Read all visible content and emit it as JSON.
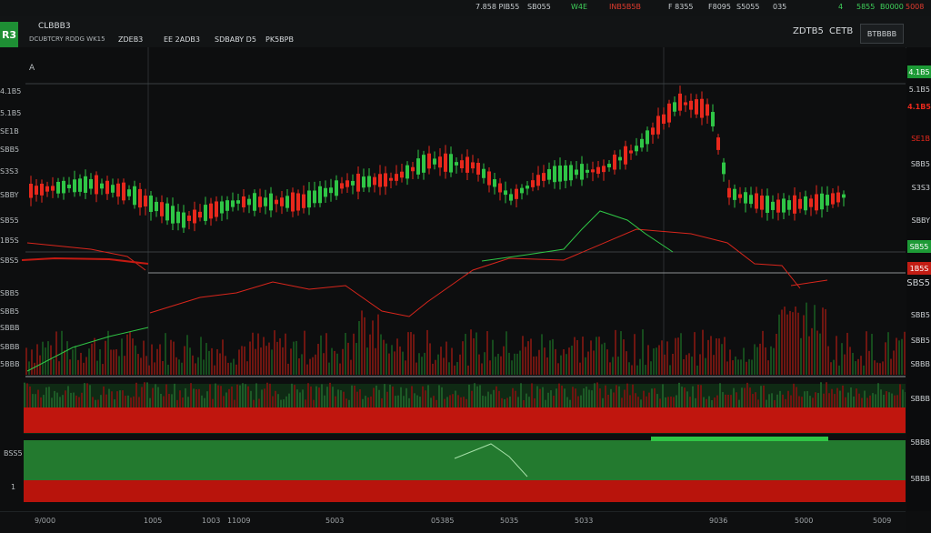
{
  "topbar": {
    "items": [
      {
        "text": "7.858 PIB55"
      },
      {
        "text": "SB055"
      },
      {
        "text": "W4E"
      },
      {
        "text": "INB5B5B"
      },
      {
        "text": "F 8355"
      },
      {
        "text": "F8095"
      },
      {
        "text": "S5055"
      },
      {
        "text": "035"
      },
      {
        "text": "4"
      },
      {
        "text": "5855"
      },
      {
        "text": "B0000"
      },
      {
        "text": "5008"
      }
    ]
  },
  "header": {
    "logo": "R3",
    "symbol": "CLBBB3",
    "subtitle": "DCUBTCRY RDDG WK15",
    "fields": [
      "ZDEB3",
      "EE 2ADB3",
      "SDBABY D5",
      "PK5BPB"
    ],
    "right_labels": [
      "ZDTB5",
      "CETB"
    ],
    "button": "BTBBBB"
  },
  "chart_labels": {
    "left_top": "A",
    "left_mid": "BSS5",
    "left_low": "1"
  },
  "y_axis": {
    "ticks": [
      "4.1B5",
      "5.1B5",
      "SE1B",
      "SBB5",
      "S3S3",
      "SBBY",
      "SB55",
      "1B5S",
      "SBS5",
      "SBB5",
      "SBB5",
      "SBBB",
      "SBBB",
      "5BBB",
      "5BBB"
    ],
    "price_green": "4.1B5",
    "price_red": "4.1B5"
  },
  "x_axis": {
    "ticks": [
      "9/000",
      "1005",
      "1003",
      "11009",
      "5003",
      "05385",
      "5035",
      "5033",
      "9036",
      "5000",
      "5009"
    ]
  },
  "colors": {
    "up": "#2fc646",
    "down": "#e8281c",
    "bg": "#0d0e0f"
  }
}
